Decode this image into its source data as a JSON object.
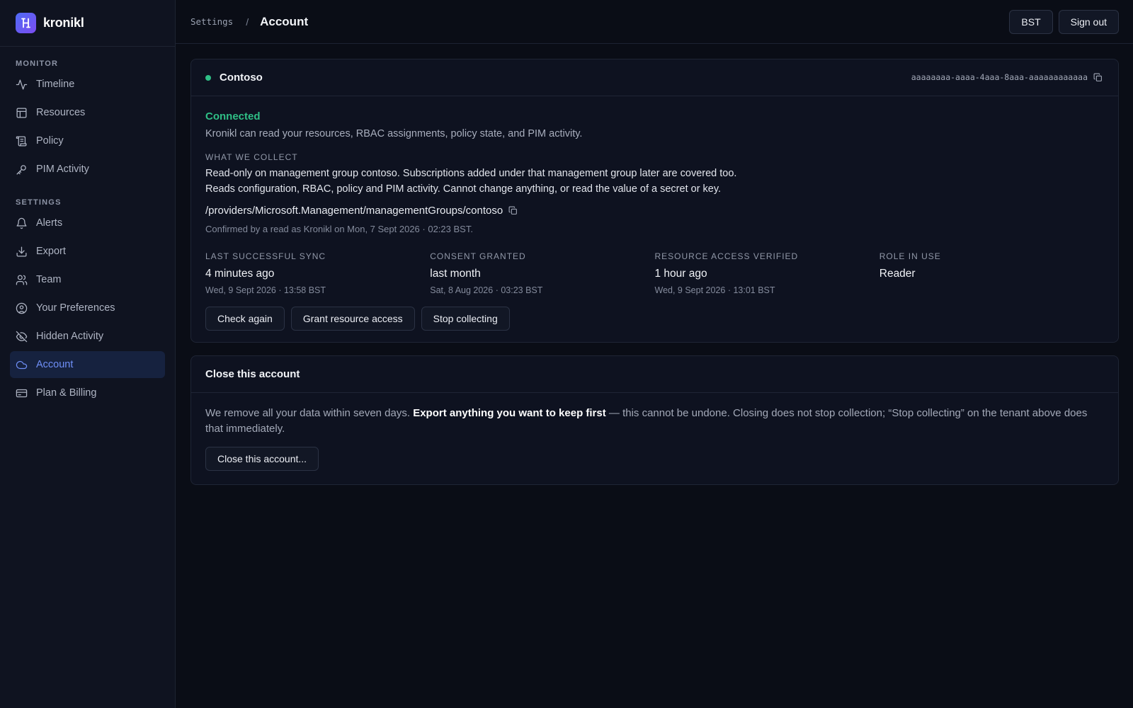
{
  "app": {
    "name": "kronikl"
  },
  "sidebar": {
    "monitor_label": "MONITOR",
    "monitor_items": [
      {
        "label": "Timeline",
        "icon": "activity-icon"
      },
      {
        "label": "Resources",
        "icon": "layout-grid-icon"
      },
      {
        "label": "Policy",
        "icon": "scroll-icon"
      },
      {
        "label": "PIM Activity",
        "icon": "key-icon"
      }
    ],
    "settings_label": "SETTINGS",
    "settings_items": [
      {
        "label": "Alerts",
        "icon": "bell-icon"
      },
      {
        "label": "Export",
        "icon": "download-icon"
      },
      {
        "label": "Team",
        "icon": "users-icon"
      },
      {
        "label": "Your Preferences",
        "icon": "user-circle-icon"
      },
      {
        "label": "Hidden Activity",
        "icon": "eye-off-icon"
      },
      {
        "label": "Account",
        "icon": "cloud-icon",
        "active": true
      },
      {
        "label": "Plan & Billing",
        "icon": "credit-card-icon"
      }
    ]
  },
  "header": {
    "breadcrumb_parent": "Settings",
    "breadcrumb_sep": "/",
    "breadcrumb_current": "Account",
    "timezone_button": "BST",
    "signout_button": "Sign out"
  },
  "tenant": {
    "name": "Contoso",
    "id": "aaaaaaaa-aaaa-4aaa-8aaa-aaaaaaaaaaaa",
    "status": "Connected",
    "status_color": "#2fbf86",
    "description": "Kronikl can read your resources, RBAC assignments, policy state, and PIM activity.",
    "collect_label": "WHAT WE COLLECT",
    "collect_line1": "Read-only on management group contoso. Subscriptions added under that management group later are covered too.",
    "collect_line2": "Reads configuration, RBAC, policy and PIM activity. Cannot change anything, or read the value of a secret or key.",
    "scope_path": "/providers/Microsoft.Management/managementGroups/contoso",
    "confirmed": "Confirmed by a read as Kronikl on Mon, 7 Sept 2026 · 02:23 BST.",
    "stats": [
      {
        "label": "LAST SUCCESSFUL SYNC",
        "value": "4 minutes ago",
        "sub": "Wed, 9 Sept 2026 · 13:58 BST"
      },
      {
        "label": "CONSENT GRANTED",
        "value": "last month",
        "sub": "Sat, 8 Aug 2026 · 03:23 BST"
      },
      {
        "label": "RESOURCE ACCESS VERIFIED",
        "value": "1 hour ago",
        "sub": "Wed, 9 Sept 2026 · 13:01 BST"
      },
      {
        "label": "ROLE IN USE",
        "value": "Reader",
        "sub": ""
      }
    ],
    "buttons": {
      "check_again": "Check again",
      "grant_access": "Grant resource access",
      "stop_collecting": "Stop collecting"
    }
  },
  "close_account": {
    "title": "Close this account",
    "text_before": "We remove all your data within seven days. ",
    "text_bold": "Export anything you want to keep first",
    "text_after": " — this cannot be undone. Closing does not stop collection; “Stop collecting” on the tenant above does that immediately.",
    "button": "Close this account..."
  }
}
